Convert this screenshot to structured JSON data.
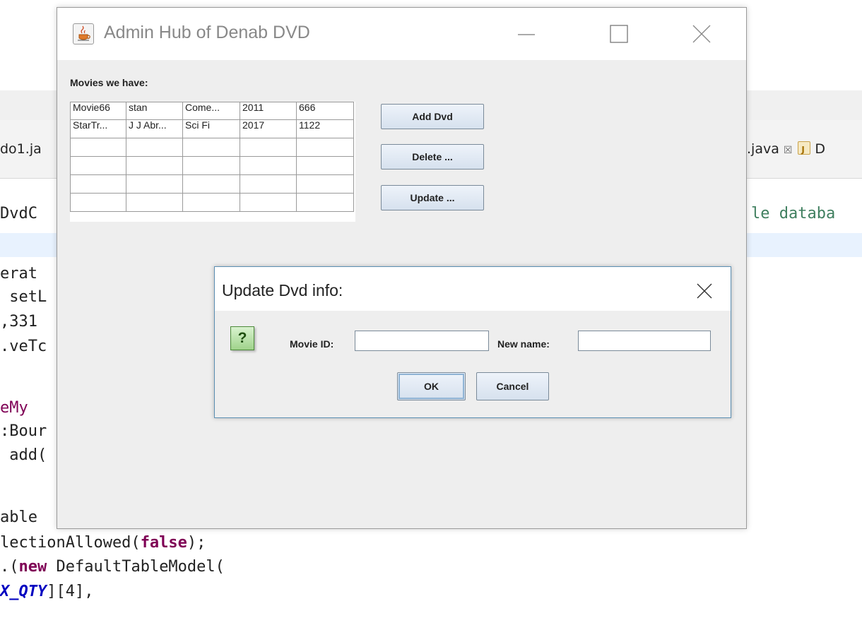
{
  "ide": {
    "tabs": [
      {
        "label": "do1.ja"
      },
      {
        "label": ".java",
        "close": "☒",
        "next_label": "D"
      }
    ],
    "code_right": "le databa",
    "code_lines": [
      "DvdC",
      "",
      "erat",
      " setL",
      ",331",
      ".veTc",
      "",
      "eMy",
      ":Bour",
      " add(",
      "",
      "able",
      "lectionAllowed(false);",
      ".(new DefaultTableModel(",
      "X_QTY][4],"
    ]
  },
  "window": {
    "title": "Admin Hub of Denab DVD",
    "movies_label": "Movies we have:",
    "table": {
      "rows": [
        [
          "Movie66",
          "stan",
          "Come...",
          "2011",
          "666"
        ],
        [
          "StarTr...",
          "J J Abr...",
          "Sci Fi",
          "2017",
          "1122"
        ],
        [
          "",
          "",
          "",
          "",
          ""
        ],
        [
          "",
          "",
          "",
          "",
          ""
        ],
        [
          "",
          "",
          "",
          "",
          ""
        ],
        [
          "",
          "",
          "",
          "",
          ""
        ]
      ]
    },
    "buttons": {
      "add": "Add Dvd",
      "delete": "Delete ...",
      "update": "Update ..."
    }
  },
  "dialog": {
    "title": "Update Dvd info:",
    "icon_glyph": "?",
    "movie_id_label": "Movie ID:",
    "movie_id_value": "",
    "new_name_label": "New name:",
    "new_name_value": "",
    "ok": "OK",
    "cancel": "Cancel"
  }
}
